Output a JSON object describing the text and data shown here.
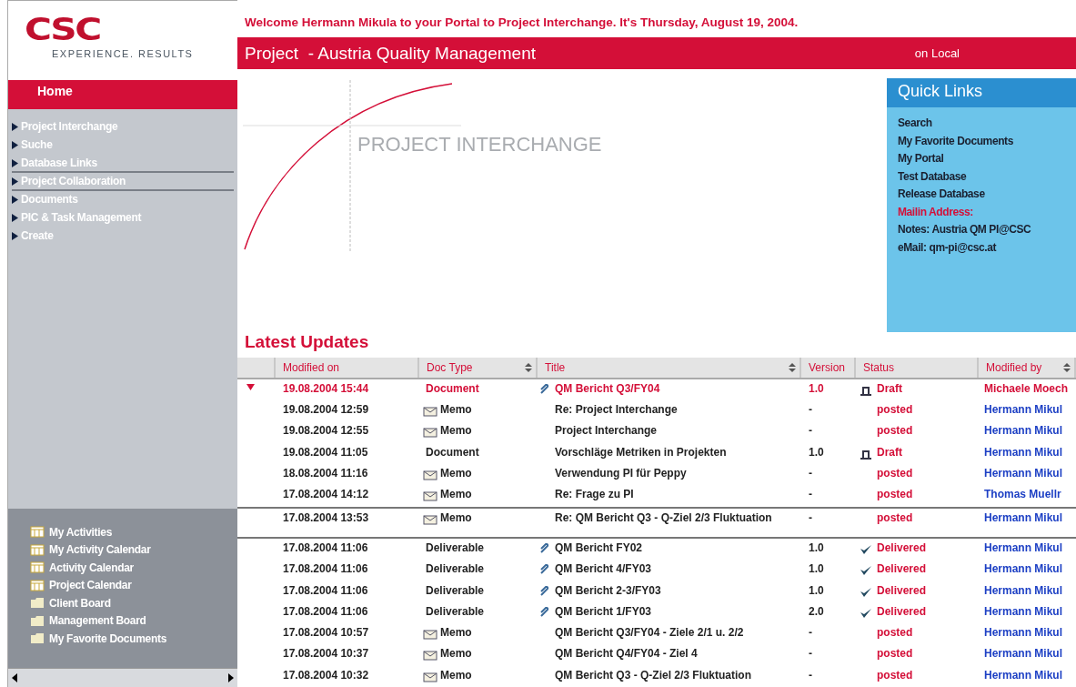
{
  "logo": {
    "mark": "CSC",
    "tagline": "EXPERIENCE. RESULTS"
  },
  "welcome": "Welcome Hermann Mikula to your Portal to Project Interchange. It's Thursday, August 19, 2004.",
  "header": {
    "title": "Project  - Austria Quality Management",
    "location": "on Local"
  },
  "sidebar": {
    "home": "Home",
    "nav": [
      {
        "label": "Project Interchange",
        "outlined": false
      },
      {
        "label": "Suche",
        "outlined": false
      },
      {
        "label": "Database Links",
        "outlined": false
      },
      {
        "label": "Project Collaboration",
        "outlined": true
      },
      {
        "label": "Documents",
        "outlined": true
      },
      {
        "label": "PIC & Task Management",
        "outlined": false
      },
      {
        "label": "Create",
        "outlined": false
      }
    ],
    "links": [
      {
        "label": "My Activities",
        "kind": "calendar"
      },
      {
        "label": "My Activity Calendar",
        "kind": "calendar"
      },
      {
        "label": "Activity Calendar",
        "kind": "calendar"
      },
      {
        "label": "Project Calendar",
        "kind": "calendar"
      },
      {
        "label": "Client Board",
        "kind": "folder"
      },
      {
        "label": "Management Board",
        "kind": "folder"
      },
      {
        "label": "My Favorite Documents",
        "kind": "folder"
      }
    ]
  },
  "banner": {
    "title": "PROJECT INTERCHANGE"
  },
  "quick_links": {
    "title": "Quick Links",
    "items": [
      {
        "label": "Search",
        "kind": "link"
      },
      {
        "label": "My Favorite Documents",
        "kind": "link"
      },
      {
        "label": "My Portal",
        "kind": "link"
      },
      {
        "label": "Test Database",
        "kind": "link"
      },
      {
        "label": "Release Database",
        "kind": "link"
      },
      {
        "label": "Mailin Address:",
        "kind": "heading"
      },
      {
        "label": "Notes: Austria QM PI@CSC",
        "kind": "text"
      },
      {
        "label": "eMail: qm-pi@csc.at",
        "kind": "text"
      }
    ]
  },
  "updates": {
    "title": "Latest Updates",
    "columns": [
      {
        "label": "Modified on",
        "sortable": false
      },
      {
        "label": "Doc Type",
        "sortable": true
      },
      {
        "label": "Title",
        "sortable": true
      },
      {
        "label": "Version",
        "sortable": false
      },
      {
        "label": "Status",
        "sortable": false
      },
      {
        "label": "Modified by",
        "sortable": true
      }
    ],
    "rows": [
      {
        "unread": true,
        "selected": false,
        "modified": "19.08.2004 15:44",
        "doc_type": {
          "kind": "document",
          "label": "Document"
        },
        "attachment": true,
        "title": "QM Bericht Q3/FY04",
        "version": "1.0",
        "status": {
          "kind": "draft",
          "label": "Draft"
        },
        "modified_by": "Michaele Moech"
      },
      {
        "unread": false,
        "selected": false,
        "modified": "19.08.2004 12:59",
        "doc_type": {
          "kind": "memo",
          "label": "Memo"
        },
        "attachment": false,
        "title": "Re: Project Interchange",
        "version": "-",
        "status": {
          "kind": "posted",
          "label": "posted"
        },
        "modified_by": "Hermann Mikul"
      },
      {
        "unread": false,
        "selected": false,
        "modified": "19.08.2004 12:55",
        "doc_type": {
          "kind": "memo",
          "label": "Memo"
        },
        "attachment": false,
        "title": "Project Interchange",
        "version": "-",
        "status": {
          "kind": "posted",
          "label": "posted"
        },
        "modified_by": "Hermann Mikul"
      },
      {
        "unread": false,
        "selected": false,
        "modified": "19.08.2004 11:05",
        "doc_type": {
          "kind": "document",
          "label": "Document"
        },
        "attachment": false,
        "title": "Vorschläge Metriken in Projekten",
        "version": "1.0",
        "status": {
          "kind": "draft",
          "label": "Draft"
        },
        "modified_by": "Hermann Mikul"
      },
      {
        "unread": false,
        "selected": false,
        "modified": "18.08.2004 11:16",
        "doc_type": {
          "kind": "memo",
          "label": "Memo"
        },
        "attachment": false,
        "title": "Verwendung PI für Peppy",
        "version": "-",
        "status": {
          "kind": "posted",
          "label": "posted"
        },
        "modified_by": "Hermann Mikul"
      },
      {
        "unread": false,
        "selected": false,
        "modified": "17.08.2004 14:12",
        "doc_type": {
          "kind": "memo",
          "label": "Memo"
        },
        "attachment": false,
        "title": "Re: Frage zu PI",
        "version": "-",
        "status": {
          "kind": "posted",
          "label": "posted"
        },
        "modified_by": "Thomas Muellr"
      },
      {
        "unread": false,
        "selected": true,
        "modified": "17.08.2004 13:53",
        "doc_type": {
          "kind": "memo",
          "label": "Memo"
        },
        "attachment": false,
        "title": "Re: QM Bericht Q3 - Q-Ziel 2/3 Fluktuation",
        "version": "-",
        "status": {
          "kind": "posted",
          "label": "posted"
        },
        "modified_by": "Hermann Mikul"
      },
      {
        "unread": false,
        "selected": false,
        "modified": "17.08.2004 11:06",
        "doc_type": {
          "kind": "deliverable",
          "label": "Deliverable"
        },
        "attachment": true,
        "title": "QM Bericht FY02",
        "version": "1.0",
        "status": {
          "kind": "delivered",
          "label": "Delivered"
        },
        "modified_by": "Hermann Mikul"
      },
      {
        "unread": false,
        "selected": false,
        "modified": "17.08.2004 11:06",
        "doc_type": {
          "kind": "deliverable",
          "label": "Deliverable"
        },
        "attachment": true,
        "title": "QM Bericht 4/FY03",
        "version": "1.0",
        "status": {
          "kind": "delivered",
          "label": "Delivered"
        },
        "modified_by": "Hermann Mikul"
      },
      {
        "unread": false,
        "selected": false,
        "modified": "17.08.2004 11:06",
        "doc_type": {
          "kind": "deliverable",
          "label": "Deliverable"
        },
        "attachment": true,
        "title": "QM Bericht 2-3/FY03",
        "version": "1.0",
        "status": {
          "kind": "delivered",
          "label": "Delivered"
        },
        "modified_by": "Hermann Mikul"
      },
      {
        "unread": false,
        "selected": false,
        "modified": "17.08.2004 11:06",
        "doc_type": {
          "kind": "deliverable",
          "label": "Deliverable"
        },
        "attachment": true,
        "title": "QM Bericht 1/FY03",
        "version": "2.0",
        "status": {
          "kind": "delivered",
          "label": "Delivered"
        },
        "modified_by": "Hermann Mikul"
      },
      {
        "unread": false,
        "selected": false,
        "modified": "17.08.2004 10:57",
        "doc_type": {
          "kind": "memo",
          "label": "Memo"
        },
        "attachment": false,
        "title": "QM Bericht Q3/FY04 - Ziele 2/1 u. 2/2",
        "version": "-",
        "status": {
          "kind": "posted",
          "label": "posted"
        },
        "modified_by": "Hermann Mikul"
      },
      {
        "unread": false,
        "selected": false,
        "modified": "17.08.2004 10:37",
        "doc_type": {
          "kind": "memo",
          "label": "Memo"
        },
        "attachment": false,
        "title": "QM Bericht Q4/FY04 - Ziel 4",
        "version": "-",
        "status": {
          "kind": "posted",
          "label": "posted"
        },
        "modified_by": "Hermann Mikul"
      },
      {
        "unread": false,
        "selected": false,
        "modified": "17.08.2004 10:32",
        "doc_type": {
          "kind": "memo",
          "label": "Memo"
        },
        "attachment": false,
        "title": "QM Bericht Q3 - Q-Ziel 2/3 Fluktuation",
        "version": "-",
        "status": {
          "kind": "posted",
          "label": "posted"
        },
        "modified_by": "Hermann Mikul"
      }
    ]
  }
}
